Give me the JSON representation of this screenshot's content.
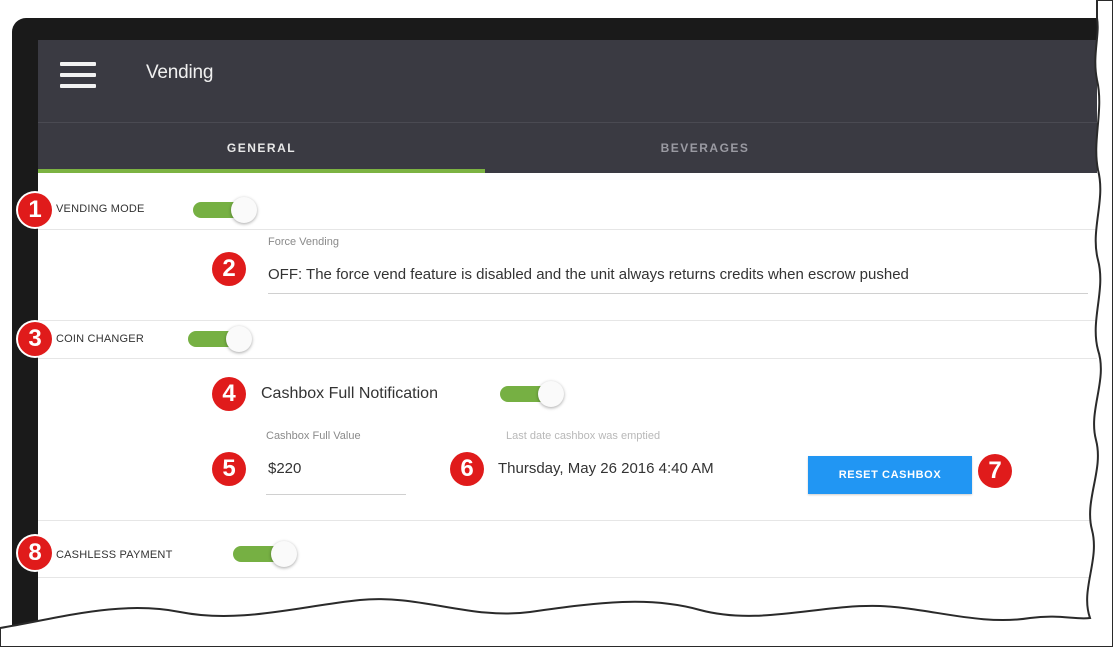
{
  "app": {
    "title": "Vending"
  },
  "tabs": [
    {
      "label": "GENERAL",
      "active": true
    },
    {
      "label": "BEVERAGES",
      "active": false
    }
  ],
  "vending_mode": {
    "label": "VENDING MODE",
    "enabled": true
  },
  "force_vending": {
    "label": "Force Vending",
    "value": "OFF: The force vend feature is disabled and the unit always returns credits when escrow pushed"
  },
  "coin_changer": {
    "label": "COIN CHANGER",
    "enabled": true
  },
  "cashbox_notification": {
    "label": "Cashbox Full Notification",
    "enabled": true
  },
  "cashbox_full_value": {
    "label": "Cashbox Full Value",
    "value": "$220"
  },
  "last_emptied": {
    "label": "Last date cashbox was emptied",
    "value": "Thursday, May 26 2016 4:40 AM"
  },
  "reset_button": {
    "label": "RESET CASHBOX"
  },
  "cashless_payment": {
    "label": "CASHLESS PAYMENT",
    "enabled": true
  },
  "callouts": [
    "1",
    "2",
    "3",
    "4",
    "5",
    "6",
    "7",
    "8"
  ],
  "colors": {
    "appbar": "#3a3a42",
    "accent_green": "#7cb342",
    "button_blue": "#2196f3",
    "callout_red": "#e01b1b"
  }
}
